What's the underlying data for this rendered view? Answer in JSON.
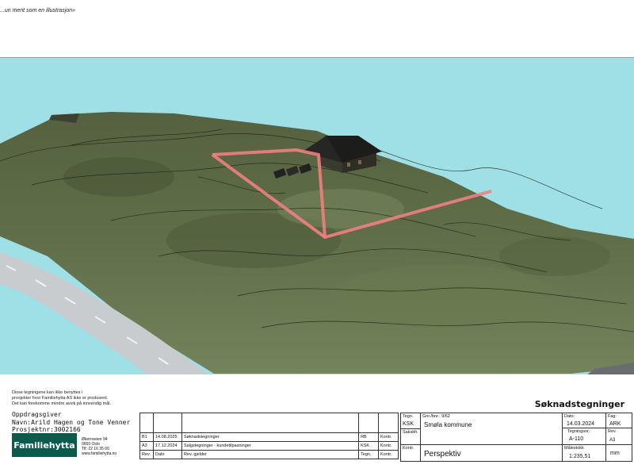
{
  "note": "...un ment som en illustrasjon»",
  "disclaimer": [
    "Disse tegningene kan ikke benyttes i",
    "prosjekter hvor Familiehytta AS ikke er produsent.",
    "Det kan forekomme mindre avvik på innvendig mål."
  ],
  "client": {
    "label": "Oppdragsgiver",
    "name_line": "Navn:Arild Hagen og Tone Venner",
    "project_line": "Prosjektnr:3002166"
  },
  "logo": "Familiehytta",
  "address": [
    "Økernveien 94",
    "0650 Oslo",
    "Tlf: 22 16 35 00",
    "www.familiehytta.no"
  ],
  "heading": "Søknadstegninger",
  "revisions": {
    "rows": [
      {
        "rev": "B1",
        "date": "14.08.2025",
        "desc": "Søknadstegninger",
        "sign": "RB",
        "ctrl": "Kontr."
      },
      {
        "rev": "A3",
        "date": "17.12.2024",
        "desc": "Salgstegninger - kundetilpasninger",
        "sign": "KSK",
        "ctrl": "Kontr."
      }
    ],
    "header": {
      "rev": "Rev.",
      "date": "Dato",
      "desc": "Rev. gjelder",
      "sign": "Tegn.",
      "ctrl": "Kontr."
    }
  },
  "title_block": {
    "drawn_by_label": "Tegn.",
    "drawn_by": "KSK",
    "case_label": "Saksbh.",
    "check_label": "Kontr.",
    "property_label": "Gnr./bnr.: 9/62",
    "municipality": "Smøla kommune",
    "drawing_title": "Perspektiv",
    "date_label": "Dato:",
    "date": "14.03.2024",
    "discipline_label": "Fag:",
    "discipline": "ARK",
    "drawing_no_label": "Tegningsnr.:",
    "drawing_no": "A-110",
    "rev_label": "Rev.",
    "format": "A3",
    "scale_label": "Målestokk",
    "scale": "1:235,51",
    "unit": "mm"
  },
  "colors": {
    "sky": "#9fdfe6",
    "terrain": "#5c6b48",
    "boundary": "#f08080",
    "road": "#c8ccce",
    "logo_bg": "#0b5b4c"
  }
}
